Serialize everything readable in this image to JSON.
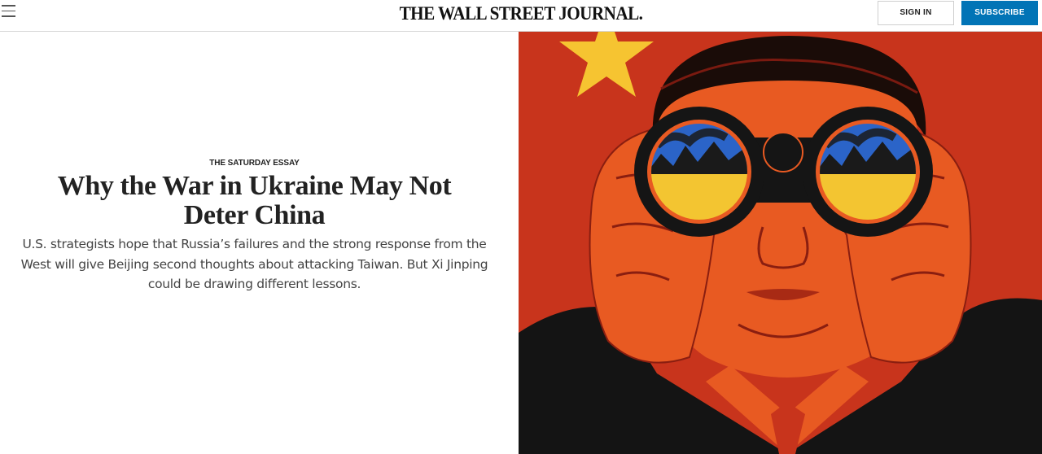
{
  "header": {
    "logo_text": "THE WALL STREET JOURNAL.",
    "signin_label": "SIGN IN",
    "subscribe_label": "SUBSCRIBE",
    "menu_icon": "hamburger-menu-icon"
  },
  "article": {
    "kicker": "THE SATURDAY ESSAY",
    "headline": "Why the War in Ukraine May Not Deter China",
    "dek": "U.S. strategists hope that Russia’s failures and the strong response from the West will give Beijing second thoughts about attacking Taiwan. But Xi Jinping could be drawing different lessons."
  },
  "colors": {
    "subscribe_bg": "#0274b6",
    "flag_red": "#c8341c",
    "star_yellow": "#f6c431",
    "skin_orange": "#e85a22",
    "lens_blue": "#2b64c8",
    "lens_yellow": "#f3c531"
  }
}
